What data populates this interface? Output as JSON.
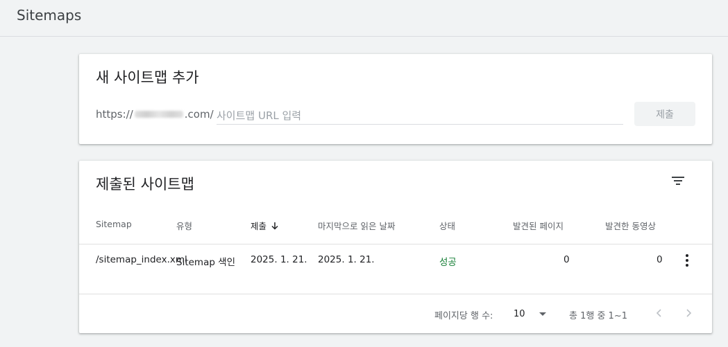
{
  "page": {
    "title": "Sitemaps"
  },
  "add_card": {
    "title": "새 사이트맵 추가",
    "url_prefix_start": "https://",
    "url_prefix_end": ".com/",
    "input_placeholder": "사이트맵 URL 입력",
    "input_value": "",
    "submit_label": "제출"
  },
  "list_card": {
    "title": "제출된 사이트맵",
    "filter_icon": "filter-list-icon",
    "columns": [
      "Sitemap",
      "유형",
      "제출",
      "마지막으로 읽은 날짜",
      "상태",
      "발견된 페이지",
      "발견한 동영상"
    ],
    "sorted_column": "제출",
    "sort_direction": "descending",
    "rows": [
      {
        "sitemap": "/sitemap_index.xml",
        "type": "Sitemap 색인",
        "submitted": "2025. 1. 21.",
        "last_read": "2025. 1. 21.",
        "status": "성공",
        "pages": "0",
        "videos": "0"
      }
    ],
    "pagination": {
      "rows_per_page_label": "페이지당 행 수:",
      "rows_per_page": "10",
      "range_text": "총 1행 중 1~1"
    }
  },
  "colors": {
    "background": "#f1f3f4",
    "status_success": "#188038",
    "text_primary": "#202124",
    "text_secondary": "#5f6368"
  }
}
